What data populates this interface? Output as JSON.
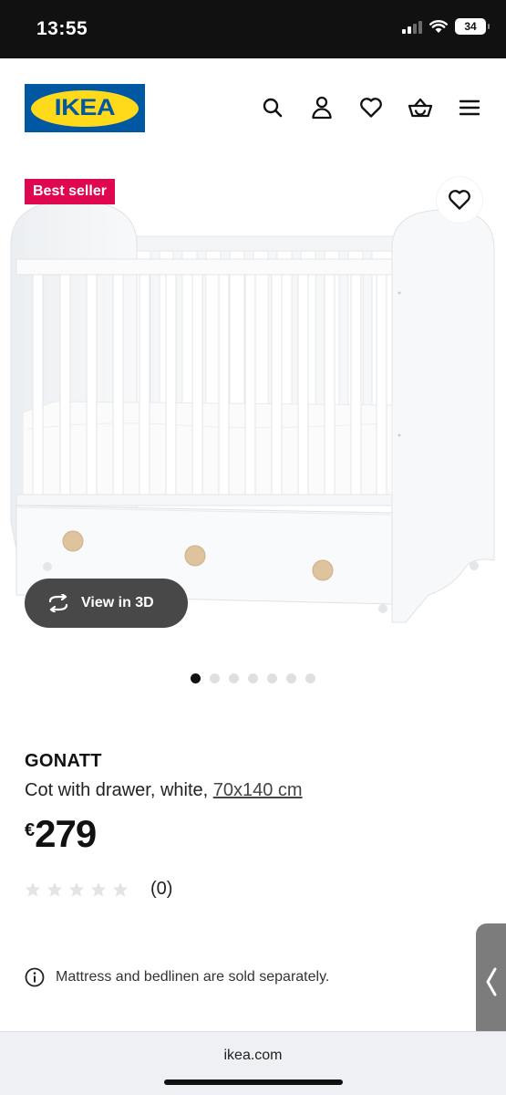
{
  "status_bar": {
    "time": "13:55",
    "battery": "34"
  },
  "header": {
    "logo_text": "IKEA",
    "icons": [
      "search-icon",
      "user-icon",
      "heart-icon",
      "basket-icon",
      "menu-icon"
    ]
  },
  "gallery": {
    "badge": "Best seller",
    "view3d_label": "View in 3D",
    "slide_count": 7,
    "active_slide": 1
  },
  "product": {
    "name": "GONATT",
    "description": "Cot with drawer, white, ",
    "size": "70x140 cm",
    "currency": "€",
    "price": "279",
    "rating_stars": 0,
    "rating_count": "(0)"
  },
  "note": {
    "text": "Mattress and bedlinen are sold separately."
  },
  "browser": {
    "url": "ikea.com"
  },
  "colors": {
    "brand_blue": "#0058a3",
    "brand_yellow": "#ffda1a",
    "badge_red": "#e00751",
    "pill_gray": "#484848"
  }
}
